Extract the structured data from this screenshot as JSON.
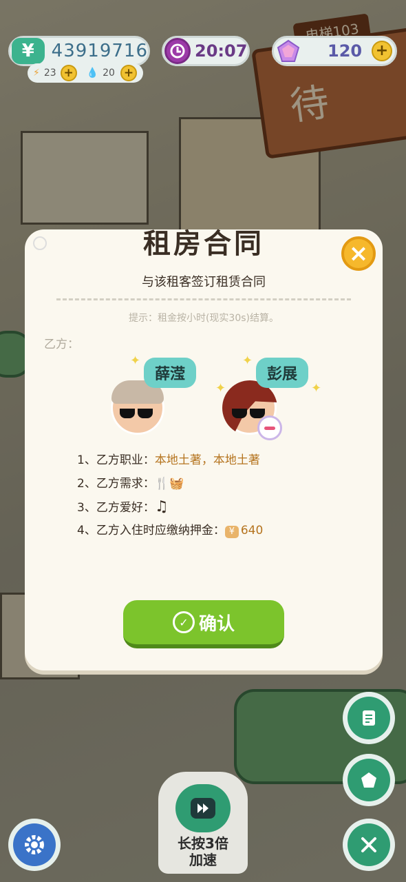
{
  "hud": {
    "money": "43919716",
    "money_icon": "¥",
    "time": "20:07",
    "gems": "120",
    "energy": "23",
    "water": "20",
    "plus": "+"
  },
  "scene": {
    "elevator_sign": "电梯103",
    "board_text": "待"
  },
  "modal": {
    "title": "租房合同",
    "subtitle": "与该租客签订租赁合同",
    "hint": "提示：租金按小时(现实30s)结算。",
    "party_label": "乙方：",
    "close": "×",
    "tenants": [
      {
        "name": "薛滢"
      },
      {
        "name": "彭展"
      }
    ],
    "terms": [
      {
        "label": "1、乙方职业：",
        "value": "本地土著，本地土著"
      },
      {
        "label": "2、乙方需求：",
        "value": "🍴🧺"
      },
      {
        "label": "3、乙方爱好：",
        "value": "♫"
      },
      {
        "label": "4、乙方入住时应缴纳押金：",
        "value": "640",
        "icon": "¥"
      }
    ],
    "confirm_label": "确认",
    "confirm_icon": "✓"
  },
  "bottom": {
    "speed_label_1": "长按3倍",
    "speed_label_2": "加速"
  },
  "colors": {
    "primary_green": "#7cc42c",
    "teal": "#2f9c72",
    "close_yellow": "#f6b82c",
    "modal_bg": "#fbf8ef"
  }
}
